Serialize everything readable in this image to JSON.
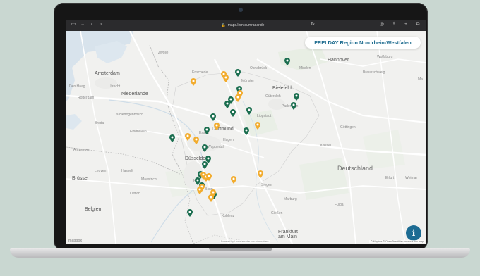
{
  "browser": {
    "url": "maps.lernraumradar.de",
    "lock_icon": "lock-icon"
  },
  "map": {
    "title": "FREI DAY Region Nordrhein-Westfalen",
    "labels": {
      "zwolle": "Zwolle",
      "amsterdam": "Amsterdam",
      "den_haag": "Den Haag",
      "utrecht": "Utrecht",
      "rotterdam": "Rotterdam",
      "niederlande": "Niederlande",
      "hertogenbosch": "'s-Hertogenbosch",
      "breda": "Breda",
      "eindhoven": "Eindhoven",
      "antwerpen": "Antwerpen",
      "brussel": "Brüssel",
      "belgien": "Belgien",
      "leuven": "Leuven",
      "hasselt": "Hasselt",
      "maastricht": "Maastricht",
      "enschede": "Enschede",
      "osnabrueck": "Osnabrück",
      "muenster": "Münster",
      "bielefeld": "Bielefeld",
      "paderborn": "Paderborn",
      "gutersloh": "Gütersloh",
      "lippstadt": "Lippstadt",
      "dortmund": "Dortmund",
      "essen": "Essen",
      "wuppertal": "Wuppertal",
      "hagen": "Hagen",
      "duesseldorf": "Düsseldorf",
      "koeln": "Köln",
      "bonn": "Bonn",
      "siegen": "Siegen",
      "marburg": "Marburg",
      "koblenz": "Koblenz",
      "frankfurt": "Frankfurt\nam Main",
      "hannover": "Hannover",
      "wolfsburg": "Wolfsburg",
      "braunschweig": "Braunschweig",
      "kassel": "Kassel",
      "goettingen": "Göttingen",
      "minden": "Minden",
      "deutschland": "Deutschland",
      "erfurt": "Erfurt",
      "weimar": "Weimar",
      "fulda": "Fulda",
      "giessen": "Gießen",
      "luettich": "Lüttich",
      "ma": "Ma"
    },
    "attribution": "© Mapbox © OpenStreetMap  Improve this map",
    "powered_by": "Powered by Lernraumradar von edmosphere",
    "info_label": "i",
    "mapbox_logo": "mapbox",
    "pin_colors": {
      "green": "#1b6e4f",
      "orange": "#f2ac2e"
    },
    "marker_count": {
      "green": 21,
      "orange": 18
    }
  }
}
